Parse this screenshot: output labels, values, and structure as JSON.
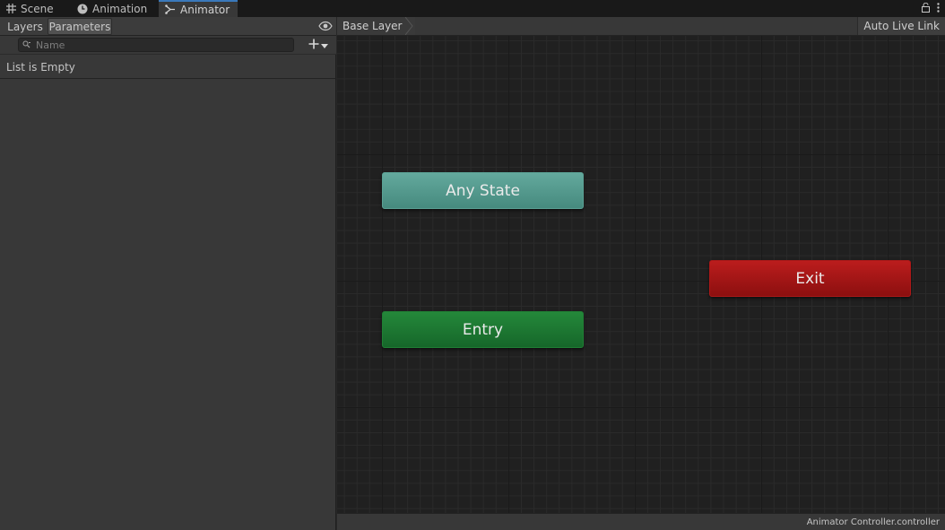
{
  "tabs": [
    {
      "label": "Scene",
      "icon": "grid-icon",
      "active": false
    },
    {
      "label": "Animation",
      "icon": "clock-icon",
      "active": false
    },
    {
      "label": "Animator",
      "icon": "animator-graph-icon",
      "active": true
    }
  ],
  "window_icons": [
    "lock-icon",
    "kebab-menu-icon"
  ],
  "left_panel": {
    "tabs": [
      {
        "label": "Layers",
        "active": false
      },
      {
        "label": "Parameters",
        "active": true
      }
    ],
    "visibility_icon": "eye-icon",
    "search": {
      "placeholder": "Name",
      "value": "",
      "icon": "search-icon"
    },
    "add_button_icon": "plus-icon",
    "empty_message": "List is Empty"
  },
  "graph": {
    "breadcrumb": "Base Layer",
    "auto_live_link": "Auto Live Link",
    "states": [
      {
        "label": "Any State",
        "color": "#5a9f93"
      },
      {
        "label": "Entry",
        "color": "#1d7a32"
      },
      {
        "label": "Exit",
        "color": "#a61616"
      }
    ]
  },
  "footer": {
    "file": "Animator Controller.controller"
  },
  "colors": {
    "accent_tab": "#3a79bb",
    "panel_bg": "#383838",
    "graph_bg": "#202020"
  }
}
